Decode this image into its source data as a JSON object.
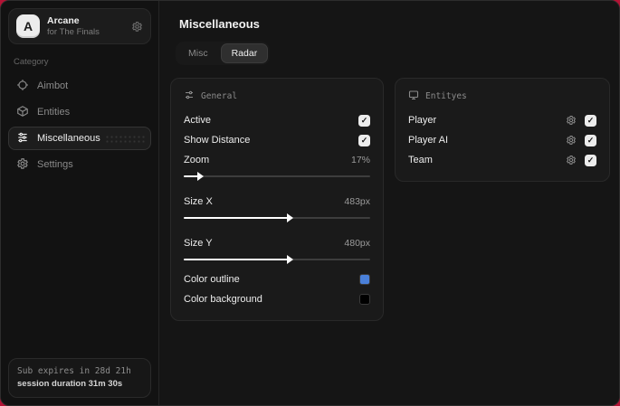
{
  "app": {
    "title": "Arcane",
    "subtitle": "for The Finals"
  },
  "colors": {
    "desktop": "#b31335",
    "outline_swatch": "#4a80d9",
    "background_swatch": "#000000"
  },
  "sidebar": {
    "category_label": "Category",
    "items": [
      {
        "label": "Aimbot",
        "active": false
      },
      {
        "label": "Entities",
        "active": false
      },
      {
        "label": "Miscellaneous",
        "active": true
      },
      {
        "label": "Settings",
        "active": false
      }
    ],
    "sub_status": {
      "line1": "Sub expires in 28d 21h",
      "line2": "session duration 31m 30s"
    }
  },
  "main": {
    "page_title": "Miscellaneous",
    "tabs": [
      {
        "label": "Misc",
        "active": false
      },
      {
        "label": "Radar",
        "active": true
      }
    ]
  },
  "general_panel": {
    "title": "General",
    "active": {
      "label": "Active",
      "checked": true
    },
    "show_distance": {
      "label": "Show Distance",
      "checked": true
    },
    "zoom": {
      "label": "Zoom",
      "value": "17%",
      "fill_pct": 8
    },
    "size_x": {
      "label": "Size X",
      "value": "483px",
      "fill_pct": 56
    },
    "size_y": {
      "label": "Size Y",
      "value": "480px",
      "fill_pct": 56
    },
    "color_outline": {
      "label": "Color outline",
      "color": "#4a80d9"
    },
    "color_background": {
      "label": "Color background",
      "color": "#000000"
    }
  },
  "entities_panel": {
    "title": "Entityes",
    "rows": [
      {
        "label": "Player",
        "checked": true
      },
      {
        "label": "Player AI",
        "checked": true
      },
      {
        "label": "Team",
        "checked": true
      }
    ]
  }
}
